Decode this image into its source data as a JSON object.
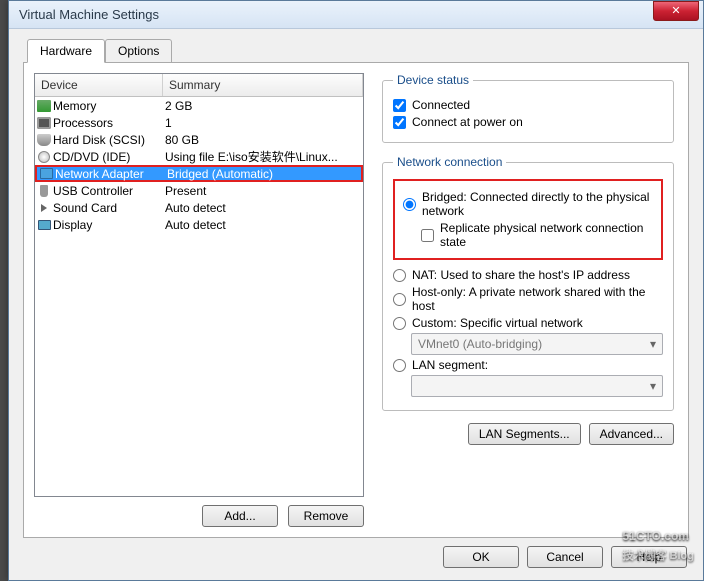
{
  "window": {
    "title": "Virtual Machine Settings"
  },
  "tabs": {
    "hardware": "Hardware",
    "options": "Options"
  },
  "columns": {
    "device": "Device",
    "summary": "Summary"
  },
  "devices": [
    {
      "icon": "memory-icon",
      "name": "Memory",
      "summary": "2 GB"
    },
    {
      "icon": "cpu-icon",
      "name": "Processors",
      "summary": "1"
    },
    {
      "icon": "hdd-icon",
      "name": "Hard Disk (SCSI)",
      "summary": "80 GB"
    },
    {
      "icon": "cd-icon",
      "name": "CD/DVD (IDE)",
      "summary": "Using file E:\\iso安装软件\\Linux..."
    },
    {
      "icon": "network-icon",
      "name": "Network Adapter",
      "summary": "Bridged (Automatic)",
      "selected": true,
      "highlight": true
    },
    {
      "icon": "usb-icon",
      "name": "USB Controller",
      "summary": "Present"
    },
    {
      "icon": "sound-icon",
      "name": "Sound Card",
      "summary": "Auto detect"
    },
    {
      "icon": "display-icon",
      "name": "Display",
      "summary": "Auto detect"
    }
  ],
  "left_buttons": {
    "add": "Add...",
    "remove": "Remove"
  },
  "status": {
    "legend": "Device status",
    "connected": "Connected",
    "connect_poweron": "Connect at power on"
  },
  "netconn": {
    "legend": "Network connection",
    "bridged": "Bridged: Connected directly to the physical network",
    "replicate": "Replicate physical network connection state",
    "nat": "NAT: Used to share the host's IP address",
    "hostonly": "Host-only: A private network shared with the host",
    "custom": "Custom: Specific virtual network",
    "custom_combo": "VMnet0 (Auto-bridging)",
    "lanseg": "LAN segment:",
    "lanseg_combo": ""
  },
  "right_buttons": {
    "lan": "LAN Segments...",
    "adv": "Advanced..."
  },
  "footer": {
    "ok": "OK",
    "cancel": "Cancel",
    "help": "Help"
  },
  "watermark": {
    "main": "51CTO.com",
    "sub": "技术博客  Blog"
  }
}
